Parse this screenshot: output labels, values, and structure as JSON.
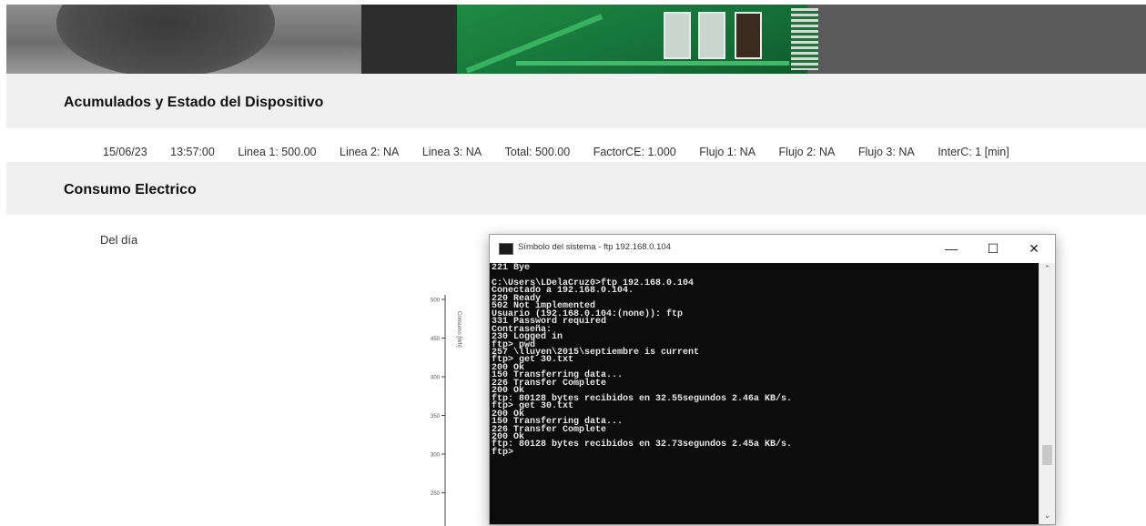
{
  "header": {
    "section_title": "Acumulados y Estado del Dispositivo"
  },
  "status": {
    "date": "15/06/23",
    "time": "13:57:00",
    "linea1": "Linea 1: 500.00",
    "linea2": "Linea 2: NA",
    "linea3": "Linea 3: NA",
    "total": "Total: 500.00",
    "factor": "FactorCE: 1.000",
    "flujo1": "Flujo 1: NA",
    "flujo2": "Flujo 2: NA",
    "flujo3": "Flujo 3: NA",
    "interc": "InterC: 1 [min]"
  },
  "consumo": {
    "section_title": "Consumo Electrico",
    "subtitle": "Del día"
  },
  "chart_data": {
    "type": "line",
    "ylabel": "Consumo [Wh]",
    "ylim": [
      250,
      500
    ],
    "yticks": [
      "500",
      "450",
      "400",
      "350",
      "300",
      "250"
    ],
    "series": []
  },
  "terminal": {
    "title": "Símbolo del sistema - ftp  192.168.0.104",
    "minimize": "—",
    "maximize": "☐",
    "close": "✕",
    "lines": [
      "221 Bye",
      "",
      "C:\\Users\\LDelaCruz0>ftp 192.168.0.104",
      "Conectado a 192.168.0.104.",
      "220 Ready",
      "502 Not implemented",
      "Usuario (192.168.0.104:(none)): ftp",
      "331 Password required",
      "Contraseña:",
      "230 Logged in",
      "ftp> pwd",
      "257 \\lluyen\\2015\\septiembre is current",
      "ftp> get 30.txt",
      "200 Ok",
      "150 Transferring data...",
      "226 Transfer Complete",
      "200 Ok",
      "ftp: 80128 bytes recibidos en 32.55segundos 2.46a KB/s.",
      "ftp> get 30.txt",
      "200 Ok",
      "150 Transferring data...",
      "226 Transfer Complete",
      "200 Ok",
      "ftp: 80128 bytes recibidos en 32.73segundos 2.45a KB/s.",
      "ftp>"
    ]
  }
}
